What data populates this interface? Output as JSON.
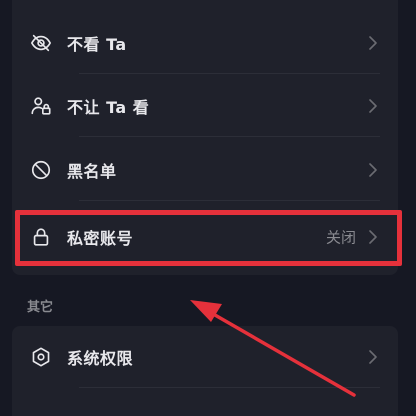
{
  "settings": {
    "items": [
      {
        "label": "不看 Ta",
        "icon": "eye-slash-icon"
      },
      {
        "label": "不让 Ta 看",
        "icon": "user-lock-icon"
      },
      {
        "label": "黑名单",
        "icon": "block-icon"
      },
      {
        "label": "私密账号",
        "icon": "lock-icon",
        "value": "关闭"
      }
    ],
    "section_other": "其它",
    "other_items": [
      {
        "label": "系统权限",
        "icon": "hexagon-shield-icon"
      }
    ]
  },
  "colors": {
    "background": "#161823",
    "card": "#1f212b",
    "annotation": "#e5313b",
    "text": "#e8e8ec",
    "muted": "#8a8b91"
  }
}
